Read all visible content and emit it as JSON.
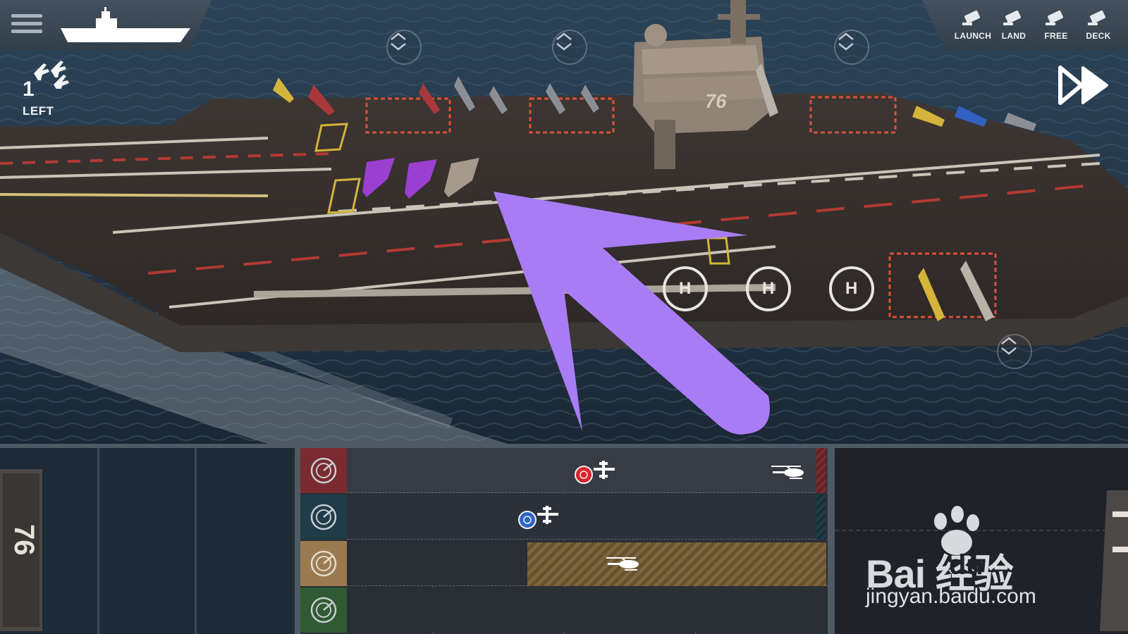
{
  "hud": {
    "menu_icon": "hamburger-menu-icon",
    "ship_icon": "aircraft-carrier-icon",
    "aircraft_left": {
      "count": "1",
      "label": "LEFT",
      "icon": "jet-squadron-icon"
    },
    "camera_buttons": [
      {
        "label": "LAUNCH",
        "icon": "camera-icon"
      },
      {
        "label": "LAND",
        "icon": "camera-icon"
      },
      {
        "label": "FREE",
        "icon": "camera-icon"
      },
      {
        "label": "DECK",
        "icon": "camera-icon"
      }
    ],
    "fast_forward_icon": "fast-forward-icon",
    "scroll_icon": "up-down-arrows-icon"
  },
  "scene": {
    "hull_number": "76",
    "helipad_marker": "H",
    "pointer_color": "#a87cf4"
  },
  "timeline": {
    "lanes": [
      {
        "color": "#7a2b2f",
        "radar_icon": "radar-icon",
        "units": [
          {
            "type": "jet",
            "badge": "#d9242b"
          },
          {
            "type": "helicopter"
          }
        ]
      },
      {
        "color": "#1f3c48",
        "radar_icon": "radar-icon",
        "units": [
          {
            "type": "jet",
            "badge": "#2f64c9"
          }
        ]
      },
      {
        "color": "#9c7a50",
        "radar_icon": "radar-icon",
        "units": [
          {
            "type": "helicopter"
          }
        ],
        "block_color": "#7d6540"
      },
      {
        "color": "#2f5a33",
        "radar_icon": "radar-icon",
        "units": []
      }
    ]
  },
  "watermark": {
    "brand": "Bai  经验",
    "brand_du": "du",
    "url": "jingyan.baidu.com"
  }
}
